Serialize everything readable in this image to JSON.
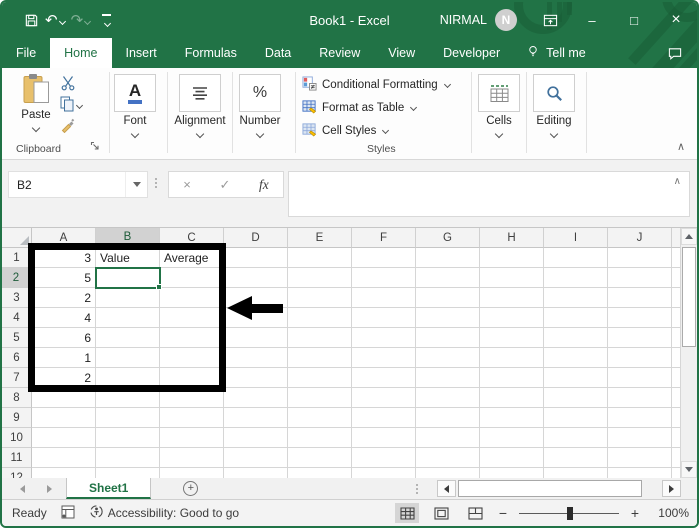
{
  "colors": {
    "excel_green": "#217346",
    "title_pattern_green": "#195c37",
    "selection_border": "#217346",
    "annotation_black": "#000000",
    "selected_header_bg": "#d2d2d2"
  },
  "titlebar": {
    "title": "Book1 - Excel",
    "user_name": "NIRMAL",
    "avatar_initial": "N"
  },
  "menu": {
    "tabs": [
      "File",
      "Home",
      "Insert",
      "Formulas",
      "Data",
      "Review",
      "View",
      "Developer"
    ],
    "active_tab": "Home",
    "tell_me": "Tell me"
  },
  "ribbon": {
    "clipboard": {
      "paste": "Paste",
      "label": "Clipboard"
    },
    "font": {
      "glyph": "A",
      "label": "Font"
    },
    "alignment": {
      "label": "Alignment"
    },
    "number": {
      "glyph": "%",
      "label": "Number"
    },
    "styles": {
      "items": [
        "Conditional Formatting",
        "Format as Table",
        "Cell Styles"
      ],
      "label": "Styles"
    },
    "cells": {
      "label": "Cells"
    },
    "editing": {
      "label": "Editing"
    }
  },
  "formula_bar": {
    "name_box_value": "B2",
    "fx_label": "fx",
    "formula_value": ""
  },
  "grid": {
    "column_headers": [
      "A",
      "B",
      "C",
      "D",
      "E",
      "F",
      "G",
      "H",
      "I",
      "J"
    ],
    "row_count": 12,
    "cells": {
      "A1": "3",
      "B1": "Value",
      "C1": "Average",
      "A2": "5",
      "A3": "2",
      "A4": "4",
      "A5": "6",
      "A6": "1",
      "A7": "2"
    },
    "selected_cell": "B2",
    "selected_column": "B",
    "selected_row": 2
  },
  "sheet_bar": {
    "active_sheet": "Sheet1"
  },
  "status_bar": {
    "mode": "Ready",
    "accessibility": "Accessibility: Good to go",
    "zoom_level": "100%"
  },
  "icons": {
    "undo": "↶",
    "redo": "↷",
    "minimize": "–",
    "maximize": "□",
    "close": "×",
    "collapse_ribbon": "∧",
    "formula_collapse": "∧",
    "cancel": "×",
    "enter": "✓",
    "new_sheet": "+",
    "zoom_out": "−",
    "zoom_in": "+"
  }
}
